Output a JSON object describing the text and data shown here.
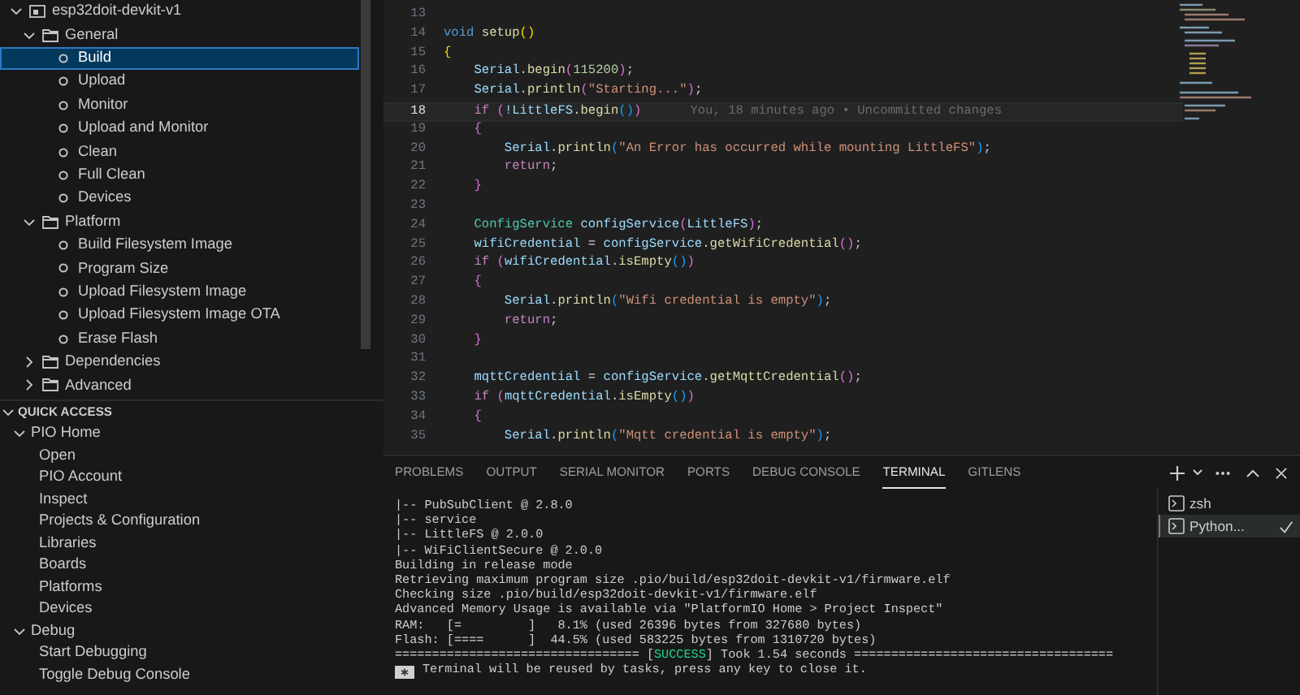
{
  "sidebar": {
    "tree": [
      {
        "label": "esp32doit-devkit-v1",
        "kind": "project",
        "expanded": true,
        "selected": false,
        "children": [
          {
            "label": "General",
            "kind": "folder",
            "expanded": true,
            "selected": false,
            "children": [
              {
                "label": "Build",
                "kind": "task",
                "selected": true
              },
              {
                "label": "Upload",
                "kind": "task",
                "selected": false
              },
              {
                "label": "Monitor",
                "kind": "task",
                "selected": false
              },
              {
                "label": "Upload and Monitor",
                "kind": "task",
                "selected": false
              },
              {
                "label": "Clean",
                "kind": "task",
                "selected": false
              },
              {
                "label": "Full Clean",
                "kind": "task",
                "selected": false
              },
              {
                "label": "Devices",
                "kind": "task",
                "selected": false
              }
            ]
          },
          {
            "label": "Platform",
            "kind": "folder",
            "expanded": true,
            "selected": false,
            "children": [
              {
                "label": "Build Filesystem Image",
                "kind": "task",
                "selected": false
              },
              {
                "label": "Program Size",
                "kind": "task",
                "selected": false
              },
              {
                "label": "Upload Filesystem Image",
                "kind": "task",
                "selected": false
              },
              {
                "label": "Upload Filesystem Image OTA",
                "kind": "task",
                "selected": false
              },
              {
                "label": "Erase Flash",
                "kind": "task",
                "selected": false
              }
            ]
          },
          {
            "label": "Dependencies",
            "kind": "folder",
            "expanded": false,
            "selected": false
          },
          {
            "label": "Advanced",
            "kind": "folder",
            "expanded": false,
            "selected": false
          }
        ]
      }
    ],
    "quick_access": {
      "title": "QUICK ACCESS",
      "expanded": true,
      "groups": [
        {
          "label": "PIO Home",
          "expanded": true,
          "children": [
            {
              "label": "Open"
            },
            {
              "label": "PIO Account"
            },
            {
              "label": "Inspect"
            },
            {
              "label": "Projects & Configuration"
            },
            {
              "label": "Libraries"
            },
            {
              "label": "Boards"
            },
            {
              "label": "Platforms"
            },
            {
              "label": "Devices"
            }
          ]
        },
        {
          "label": "Debug",
          "expanded": true,
          "children": [
            {
              "label": "Start Debugging"
            },
            {
              "label": "Toggle Debug Console"
            }
          ]
        }
      ]
    }
  },
  "editor": {
    "lines": [
      {
        "number": "13",
        "active": false
      },
      {
        "number": "14",
        "active": false,
        "tokens": [
          {
            "text": "void",
            "kind": "kw"
          },
          {
            "text": " setup",
            "kind": "fn"
          },
          {
            "text": "()",
            "kind": "b1"
          }
        ]
      },
      {
        "number": "15",
        "active": false,
        "tokens": [
          {
            "text": "{",
            "kind": "b1"
          }
        ]
      },
      {
        "number": "16",
        "active": false,
        "tokens": [
          {
            "text": "    Serial",
            "kind": "var"
          },
          {
            "text": ".begin",
            "kind": "fn"
          },
          {
            "text": "(",
            "kind": "b2"
          },
          {
            "text": "115200",
            "kind": "num"
          },
          {
            "text": ")",
            "kind": "b2"
          },
          {
            "text": ";",
            "kind": "p"
          }
        ]
      },
      {
        "number": "17",
        "active": false,
        "tokens": [
          {
            "text": "    Serial",
            "kind": "var"
          },
          {
            "text": ".println",
            "kind": "fn"
          },
          {
            "text": "(",
            "kind": "b2"
          },
          {
            "text": "\"Starting...\"",
            "kind": "str"
          },
          {
            "text": ")",
            "kind": "b2"
          },
          {
            "text": ";",
            "kind": "p"
          }
        ]
      },
      {
        "number": "18",
        "active": true,
        "annotation": "You, 18 minutes ago • Uncommitted changes",
        "tokens": [
          {
            "text": "    if",
            "kind": "ctrl"
          },
          {
            "text": " (",
            "kind": "b2"
          },
          {
            "text": "!LittleFS",
            "kind": "var"
          },
          {
            "text": ".begin",
            "kind": "fn"
          },
          {
            "text": "()",
            "kind": "b3"
          },
          {
            "text": ")",
            "kind": "b2"
          }
        ]
      },
      {
        "number": "19",
        "active": false,
        "tokens": [
          {
            "text": "    {",
            "kind": "b2"
          }
        ]
      },
      {
        "number": "20",
        "active": false,
        "tokens": [
          {
            "text": "        Serial",
            "kind": "var"
          },
          {
            "text": ".println",
            "kind": "fn"
          },
          {
            "text": "(",
            "kind": "b3"
          },
          {
            "text": "\"An Error has occurred while mounting LittleFS\"",
            "kind": "str"
          },
          {
            "text": ")",
            "kind": "b3"
          },
          {
            "text": ";",
            "kind": "p"
          }
        ]
      },
      {
        "number": "21",
        "active": false,
        "tokens": [
          {
            "text": "        return",
            "kind": "ctrl"
          },
          {
            "text": ";",
            "kind": "p"
          }
        ]
      },
      {
        "number": "22",
        "active": false,
        "tokens": [
          {
            "text": "    }",
            "kind": "b2"
          }
        ]
      },
      {
        "number": "23",
        "active": false
      },
      {
        "number": "24",
        "active": false,
        "tokens": [
          {
            "text": "    ConfigService",
            "kind": "type"
          },
          {
            "text": " configService",
            "kind": "var"
          },
          {
            "text": "(",
            "kind": "b2"
          },
          {
            "text": "LittleFS",
            "kind": "var"
          },
          {
            "text": ")",
            "kind": "b2"
          },
          {
            "text": ";",
            "kind": "p"
          }
        ]
      },
      {
        "number": "25",
        "active": false,
        "tokens": [
          {
            "text": "    wifiCredential",
            "kind": "var"
          },
          {
            "text": " = ",
            "kind": "p"
          },
          {
            "text": "configService",
            "kind": "var"
          },
          {
            "text": ".getWifiCredential",
            "kind": "fn"
          },
          {
            "text": "()",
            "kind": "b2"
          },
          {
            "text": ";",
            "kind": "p"
          }
        ]
      },
      {
        "number": "26",
        "active": false,
        "tokens": [
          {
            "text": "    if",
            "kind": "ctrl"
          },
          {
            "text": " (",
            "kind": "b2"
          },
          {
            "text": "wifiCredential",
            "kind": "var"
          },
          {
            "text": ".isEmpty",
            "kind": "fn"
          },
          {
            "text": "()",
            "kind": "b3"
          },
          {
            "text": ")",
            "kind": "b2"
          }
        ]
      },
      {
        "number": "27",
        "active": false,
        "tokens": [
          {
            "text": "    {",
            "kind": "b2"
          }
        ]
      },
      {
        "number": "28",
        "active": false,
        "tokens": [
          {
            "text": "        Serial",
            "kind": "var"
          },
          {
            "text": ".println",
            "kind": "fn"
          },
          {
            "text": "(",
            "kind": "b3"
          },
          {
            "text": "\"Wifi credential is empty\"",
            "kind": "str"
          },
          {
            "text": ")",
            "kind": "b3"
          },
          {
            "text": ";",
            "kind": "p"
          }
        ]
      },
      {
        "number": "29",
        "active": false,
        "tokens": [
          {
            "text": "        return",
            "kind": "ctrl"
          },
          {
            "text": ";",
            "kind": "p"
          }
        ]
      },
      {
        "number": "30",
        "active": false,
        "tokens": [
          {
            "text": "    }",
            "kind": "b2"
          }
        ]
      },
      {
        "number": "31",
        "active": false
      },
      {
        "number": "32",
        "active": false,
        "tokens": [
          {
            "text": "    mqttCredential",
            "kind": "var"
          },
          {
            "text": " = ",
            "kind": "p"
          },
          {
            "text": "configService",
            "kind": "var"
          },
          {
            "text": ".getMqttCredential",
            "kind": "fn"
          },
          {
            "text": "()",
            "kind": "b2"
          },
          {
            "text": ";",
            "kind": "p"
          }
        ]
      },
      {
        "number": "33",
        "active": false,
        "tokens": [
          {
            "text": "    if",
            "kind": "ctrl"
          },
          {
            "text": " (",
            "kind": "b2"
          },
          {
            "text": "mqttCredential",
            "kind": "var"
          },
          {
            "text": ".isEmpty",
            "kind": "fn"
          },
          {
            "text": "()",
            "kind": "b3"
          },
          {
            "text": ")",
            "kind": "b2"
          }
        ]
      },
      {
        "number": "34",
        "active": false,
        "tokens": [
          {
            "text": "    {",
            "kind": "b2"
          }
        ]
      },
      {
        "number": "35",
        "active": false,
        "tokens": [
          {
            "text": "        Serial",
            "kind": "var"
          },
          {
            "text": ".println",
            "kind": "fn"
          },
          {
            "text": "(",
            "kind": "b3"
          },
          {
            "text": "\"Mqtt credential is empty\"",
            "kind": "str"
          },
          {
            "text": ")",
            "kind": "b3"
          },
          {
            "text": ";",
            "kind": "p"
          }
        ]
      }
    ]
  },
  "panel": {
    "tabs": [
      {
        "label": "PROBLEMS",
        "selected": false
      },
      {
        "label": "OUTPUT",
        "selected": false
      },
      {
        "label": "SERIAL MONITOR",
        "selected": false
      },
      {
        "label": "PORTS",
        "selected": false
      },
      {
        "label": "DEBUG CONSOLE",
        "selected": false
      },
      {
        "label": "TERMINAL",
        "selected": true
      },
      {
        "label": "GITLENS",
        "selected": false
      }
    ],
    "terminal": [
      {
        "kind": "plain",
        "parts": [
          {
            "text": "|-- PubSubClient @ 2.8.0",
            "kind": "plain"
          }
        ]
      },
      {
        "kind": "plain",
        "parts": [
          {
            "text": "|-- service",
            "kind": "plain"
          }
        ]
      },
      {
        "kind": "plain",
        "parts": [
          {
            "text": "|-- LittleFS @ 2.0.0",
            "kind": "plain"
          }
        ]
      },
      {
        "kind": "plain",
        "parts": [
          {
            "text": "|-- WiFiClientSecure @ 2.0.0",
            "kind": "plain"
          }
        ]
      },
      {
        "kind": "plain",
        "parts": [
          {
            "text": "Building in release mode",
            "kind": "plain"
          }
        ]
      },
      {
        "kind": "plain",
        "parts": [
          {
            "text": "Retrieving maximum program size .pio/build/esp32doit-devkit-v1/firmware.elf",
            "kind": "plain"
          }
        ]
      },
      {
        "kind": "plain",
        "parts": [
          {
            "text": "Checking size .pio/build/esp32doit-devkit-v1/firmware.elf",
            "kind": "plain"
          }
        ]
      },
      {
        "kind": "plain",
        "parts": [
          {
            "text": "Advanced Memory Usage is available via \"PlatformIO Home > Project Inspect\"",
            "kind": "plain"
          }
        ]
      },
      {
        "kind": "plain",
        "parts": [
          {
            "text": "RAM:   [=         ]   8.1% (used 26396 bytes from 327680 bytes)",
            "kind": "plain"
          }
        ]
      },
      {
        "kind": "plain",
        "parts": [
          {
            "text": "Flash: [====      ]  44.5% (used 583225 bytes from 1310720 bytes)",
            "kind": "plain"
          }
        ]
      },
      {
        "kind": "plain",
        "parts": [
          {
            "text": "================================= [",
            "kind": "plain"
          },
          {
            "text": "SUCCESS",
            "kind": "success"
          },
          {
            "text": "] Took 1.54 seconds ===================================",
            "kind": "plain"
          }
        ]
      },
      {
        "kind": "notice",
        "parts": [
          {
            "text": "Terminal will be reused by tasks, press any key to close it.",
            "kind": "plain"
          }
        ]
      }
    ],
    "sessions": [
      {
        "label": "zsh",
        "selected": false,
        "done": false
      },
      {
        "label": "Python...",
        "selected": true,
        "done": true
      }
    ]
  }
}
